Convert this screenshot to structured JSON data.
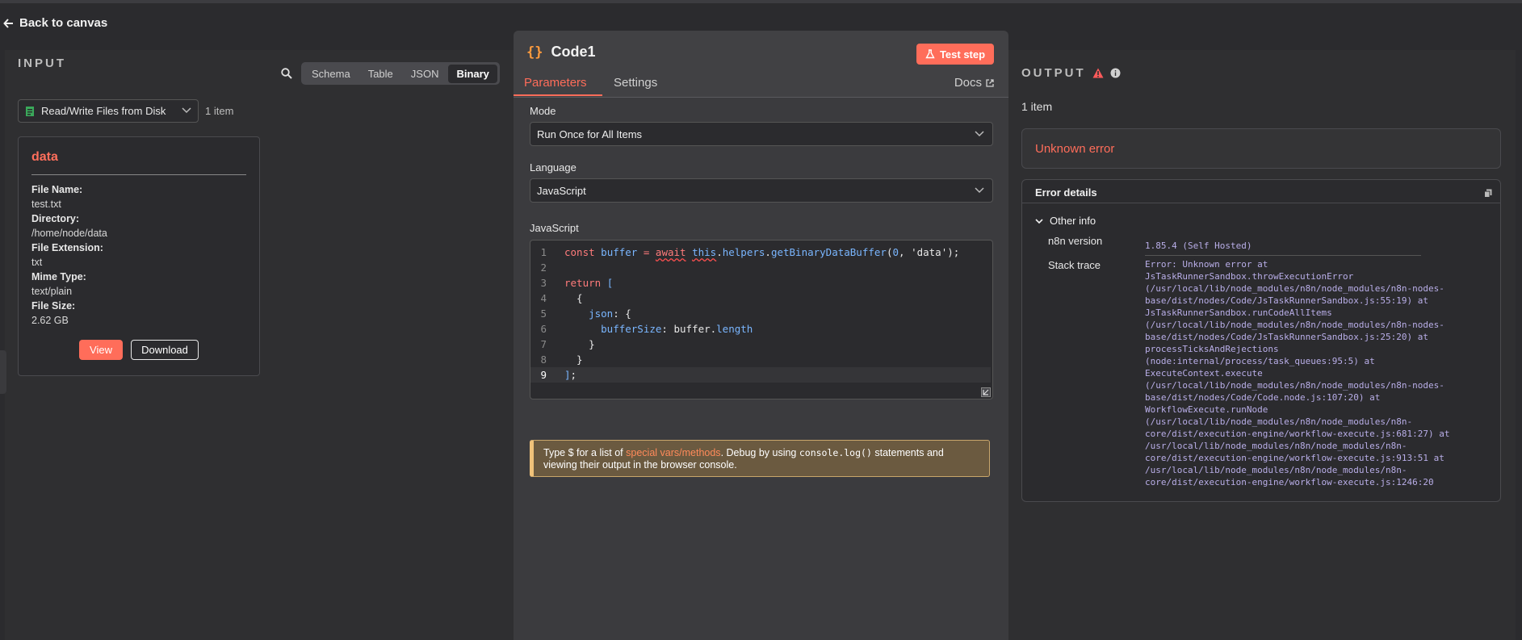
{
  "back_label": "Back to canvas",
  "input": {
    "title": "INPUT",
    "views": [
      "Schema",
      "Table",
      "JSON",
      "Binary"
    ],
    "active_view": "Binary",
    "node_select": "Read/Write Files from Disk",
    "item_count": "1 item",
    "binary": {
      "name": "data",
      "fields": [
        {
          "key": "File Name:",
          "value": "test.txt"
        },
        {
          "key": "Directory:",
          "value": "/home/node/data"
        },
        {
          "key": "File Extension:",
          "value": "txt"
        },
        {
          "key": "Mime Type:",
          "value": "text/plain"
        },
        {
          "key": "File Size:",
          "value": "2.62 GB"
        }
      ],
      "view_label": "View",
      "download_label": "Download"
    }
  },
  "node": {
    "title": "Code1",
    "test_step_label": "Test step",
    "tabs": [
      "Parameters",
      "Settings"
    ],
    "docs_label": "Docs",
    "mode_label": "Mode",
    "mode_value": "Run Once for All Items",
    "language_label": "Language",
    "language_value": "JavaScript",
    "code_label": "JavaScript",
    "code_lines": [
      "const buffer = await this.helpers.getBinaryDataBuffer(0, 'data');",
      "",
      "return [",
      "  {",
      "    json: {",
      "      bufferSize: buffer.length",
      "    }",
      "  }",
      "];"
    ],
    "hint": {
      "prefix": "Type $ for a list of ",
      "link": "special vars/methods",
      "middle": ". Debug by using ",
      "code": "console.log()",
      "suffix": " statements and viewing their output in the browser console."
    }
  },
  "output": {
    "title": "OUTPUT",
    "item_count": "1 item",
    "error_title": "Unknown error",
    "details_title": "Error details",
    "other_info_label": "Other info",
    "n8n_version_label": "n8n version",
    "n8n_version_value": "1.85.4 (Self Hosted)",
    "stack_trace_label": "Stack trace",
    "stack_trace_lines": [
      "Error: Unknown error at",
      "JsTaskRunnerSandbox.throwExecutionError",
      "(/usr/local/lib/node_modules/n8n/node_modules/n8n-nodes-",
      "base/dist/nodes/Code/JsTaskRunnerSandbox.js:55:19) at",
      "JsTaskRunnerSandbox.runCodeAllItems",
      "(/usr/local/lib/node_modules/n8n/node_modules/n8n-nodes-",
      "base/dist/nodes/Code/JsTaskRunnerSandbox.js:25:20) at",
      "processTicksAndRejections",
      "(node:internal/process/task_queues:95:5) at",
      "ExecuteContext.execute",
      "(/usr/local/lib/node_modules/n8n/node_modules/n8n-nodes-",
      "base/dist/nodes/Code/Code.node.js:107:20) at",
      "WorkflowExecute.runNode",
      "(/usr/local/lib/node_modules/n8n/node_modules/n8n-",
      "core/dist/execution-engine/workflow-execute.js:681:27) at",
      "/usr/local/lib/node_modules/n8n/node_modules/n8n-",
      "core/dist/execution-engine/workflow-execute.js:913:51 at",
      "/usr/local/lib/node_modules/n8n/node_modules/n8n-",
      "core/dist/execution-engine/workflow-execute.js:1246:20"
    ]
  },
  "colors": {
    "accent": "#ff6d5a",
    "background": "#2b2b2e",
    "stack_text": "#b9aee8"
  }
}
